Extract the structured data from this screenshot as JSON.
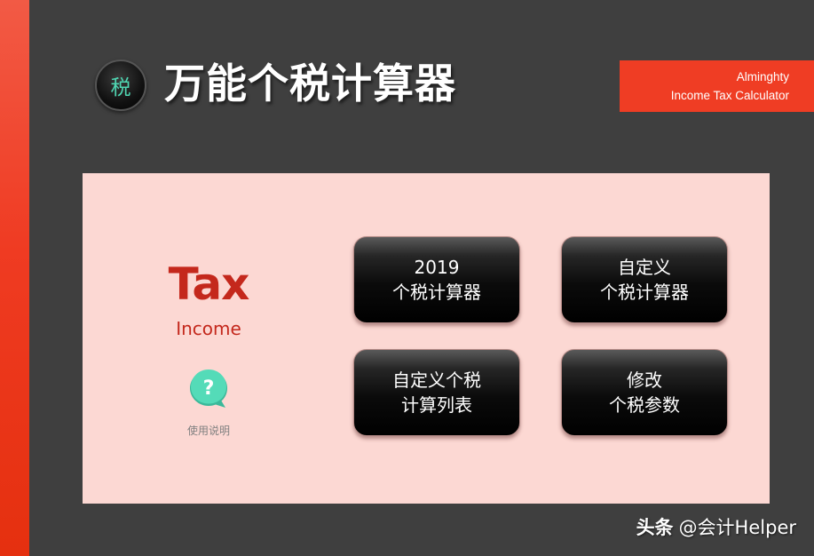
{
  "colors": {
    "accent_red": "#ef3d24",
    "background_dark": "#3f3f3f",
    "panel_pink": "#fcd8d3",
    "tax_red": "#c4281c",
    "help_teal": "#4fd6b2"
  },
  "header": {
    "logo_glyph": "税",
    "title": "万能个税计算器",
    "badge_line1": "Alminghty",
    "badge_line2": "Income Tax Calculator"
  },
  "panel": {
    "tax_word": "Tax",
    "income_word": "Income",
    "help_icon": "question-mark-speech-bubble",
    "help_caption": "使用说明"
  },
  "menu": [
    {
      "line1": "2019",
      "line2": "个税计算器"
    },
    {
      "line1": "自定义",
      "line2": "个税计算器"
    },
    {
      "line1": "自定义个税",
      "line2": "计算列表"
    },
    {
      "line1": "修改",
      "line2": "个税参数"
    }
  ],
  "watermark": {
    "brand": "头条",
    "handle": "@会计Helper"
  }
}
